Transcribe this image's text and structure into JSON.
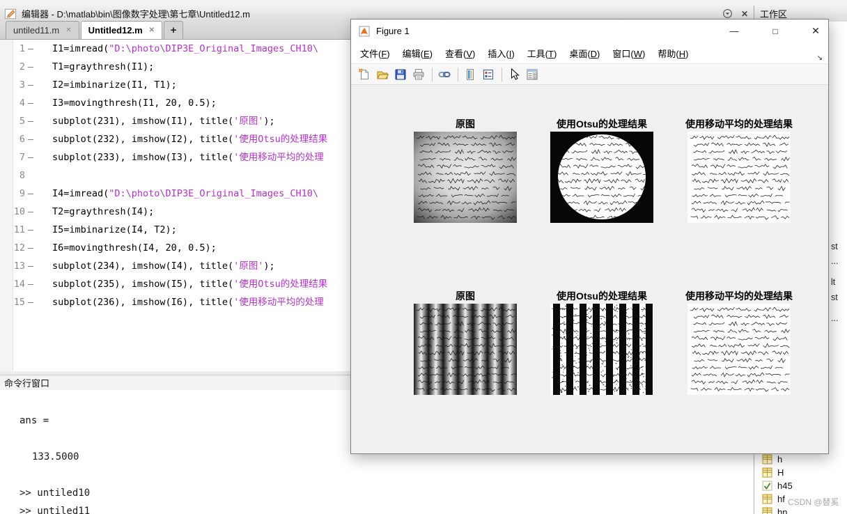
{
  "colors": {
    "string_literal": "#b82fd0",
    "figure_canvas_gray": "#f0f0f0",
    "workspace_icon_yellow": "#fdf3c4"
  },
  "editor": {
    "window_title": "编辑器 - D:\\matlab\\bin\\图像数字处理\\第七章\\Untitled12.m",
    "tabs": [
      {
        "label": "untiled11.m"
      },
      {
        "label": "Untitled12.m"
      }
    ],
    "active_tab": "Untitled12.m",
    "new_tab_label": "+",
    "code_lines": [
      {
        "n": "1",
        "segs": [
          {
            "c": "code",
            "t": "I1=imread("
          },
          {
            "c": "str",
            "t": "\"D:\\photo\\DIP3E_Original_Images_CH10\\"
          }
        ]
      },
      {
        "n": "2",
        "segs": [
          {
            "c": "code",
            "t": "T1=graythresh(I1);"
          }
        ]
      },
      {
        "n": "3",
        "segs": [
          {
            "c": "code",
            "t": "I2=imbinarize(I1, T1);"
          }
        ]
      },
      {
        "n": "4",
        "segs": [
          {
            "c": "code",
            "t": "I3=movingthresh(I1, 20, 0.5);"
          }
        ]
      },
      {
        "n": "5",
        "segs": [
          {
            "c": "code",
            "t": "subplot(231), imshow(I1), title("
          },
          {
            "c": "str",
            "t": "'原图'"
          },
          {
            "c": "code",
            "t": ");"
          }
        ]
      },
      {
        "n": "6",
        "segs": [
          {
            "c": "code",
            "t": "subplot(232), imshow(I2), title("
          },
          {
            "c": "str",
            "t": "'使用Otsu的处理结果"
          }
        ]
      },
      {
        "n": "7",
        "segs": [
          {
            "c": "code",
            "t": "subplot(233), imshow(I3), title("
          },
          {
            "c": "str",
            "t": "'使用移动平均的处理"
          }
        ]
      },
      {
        "n": "8",
        "segs": []
      },
      {
        "n": "9",
        "segs": [
          {
            "c": "code",
            "t": "I4=imread("
          },
          {
            "c": "str",
            "t": "\"D:\\photo\\DIP3E_Original_Images_CH10\\"
          }
        ]
      },
      {
        "n": "10",
        "segs": [
          {
            "c": "code",
            "t": "T2=graythresh(I4);"
          }
        ]
      },
      {
        "n": "11",
        "segs": [
          {
            "c": "code",
            "t": "I5=imbinarize(I4, T2);"
          }
        ]
      },
      {
        "n": "12",
        "segs": [
          {
            "c": "code",
            "t": "I6=movingthresh(I4, 20, 0.5);"
          }
        ]
      },
      {
        "n": "13",
        "segs": [
          {
            "c": "code",
            "t": "subplot(234), imshow(I4), title("
          },
          {
            "c": "str",
            "t": "'原图'"
          },
          {
            "c": "code",
            "t": ");"
          }
        ]
      },
      {
        "n": "14",
        "segs": [
          {
            "c": "code",
            "t": "subplot(235), imshow(I5), title("
          },
          {
            "c": "str",
            "t": "'使用Otsu的处理结果"
          }
        ]
      },
      {
        "n": "15",
        "segs": [
          {
            "c": "code",
            "t": "subplot(236), imshow(I6), title("
          },
          {
            "c": "str",
            "t": "'使用移动平均的处理"
          }
        ]
      }
    ]
  },
  "command_window": {
    "header": "命令行窗口",
    "lines": [
      "ans =",
      "133.5000",
      ">> untiled10",
      ">> untiled11"
    ]
  },
  "workspace": {
    "header": "工作区",
    "variables": [
      {
        "name": "h",
        "checked": false
      },
      {
        "name": "H",
        "checked": false
      },
      {
        "name": "h45",
        "checked": true
      },
      {
        "name": "hf",
        "checked": false
      },
      {
        "name": "hn",
        "checked": false
      }
    ],
    "edge_fragments": [
      "st",
      "...",
      "lt",
      "st",
      "..."
    ]
  },
  "watermark": "CSDN @替奚",
  "figure_window": {
    "title": "Figure 1",
    "menus": [
      {
        "label": "文件",
        "key": "F"
      },
      {
        "label": "编辑",
        "key": "E"
      },
      {
        "label": "查看",
        "key": "V"
      },
      {
        "label": "插入",
        "key": "I"
      },
      {
        "label": "工具",
        "key": "T"
      },
      {
        "label": "桌面",
        "key": "D"
      },
      {
        "label": "窗口",
        "key": "W"
      },
      {
        "label": "帮助",
        "key": "H"
      }
    ],
    "toolbar": [
      "new-figure",
      "open-file",
      "save-figure",
      "print-figure",
      "link-plot",
      "insert-colorbar",
      "insert-legend",
      "edit-plot",
      "property-inspector"
    ],
    "window_buttons": [
      "minimize",
      "maximize",
      "close"
    ],
    "subplot_titles": [
      "原图",
      "使用Otsu的处理结果",
      "使用移动平均的处理结果",
      "原图",
      "使用Otsu的处理结果",
      "使用移动平均的处理结果"
    ]
  }
}
